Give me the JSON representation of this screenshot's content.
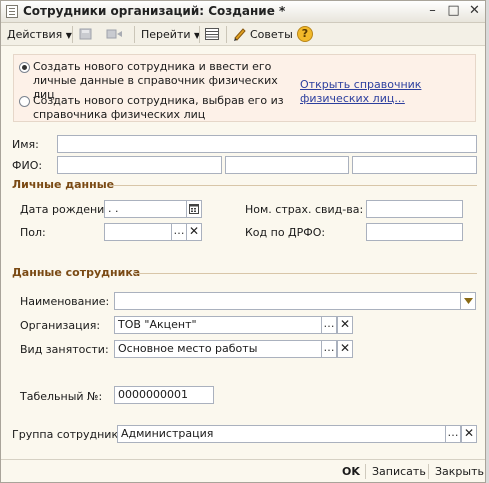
{
  "window": {
    "title": "Сотрудники организаций: Создание *",
    "minimize": "–",
    "maximize": "□",
    "close": "✕"
  },
  "toolbar": {
    "actions_label": "Действия",
    "goto_label": "Перейти",
    "tips_label": "Советы",
    "help_label": "?"
  },
  "mode_panel": {
    "option_new_label": "Создать нового сотрудника и ввести его личные данные в справочник физических лиц",
    "option_existing_label": "Создать нового сотрудника, выбрав его из справочника физических лиц",
    "selected": "option_new",
    "open_directory_link": "Открыть справочник физических лиц..."
  },
  "person": {
    "name_label": "Имя:",
    "name_value": "",
    "fio_label": "ФИО:",
    "fio_values": [
      "",
      "",
      ""
    ]
  },
  "personal": {
    "section_title": "Личные данные",
    "birth_label": "Дата рождения:",
    "birth_value": " .  .",
    "gender_label": "Пол:",
    "gender_value": "",
    "insurance_label": "Ном. страх. свид-ва:",
    "insurance_value": "",
    "drfo_label": "Код по ДРФО:",
    "drfo_value": ""
  },
  "employee": {
    "section_title": "Данные сотрудника",
    "name_label": "Наименование:",
    "name_value": "",
    "org_label": "Организация:",
    "org_value": "ТОВ \"Акцент\"",
    "employment_label": "Вид занятости:",
    "employment_value": "Основное место работы",
    "tab_label": "Табельный №:",
    "tab_value": "0000000001",
    "group_label": "Группа сотрудника:",
    "group_value": "Администрация"
  },
  "footer": {
    "ok_label": "OK",
    "save_label": "Записать",
    "close_label": "Закрыть"
  },
  "colors": {
    "window_bg": "#fbf8ee",
    "section_title": "#7a4a14",
    "link": "#2c3f9e",
    "field_border": "#aab1be"
  }
}
